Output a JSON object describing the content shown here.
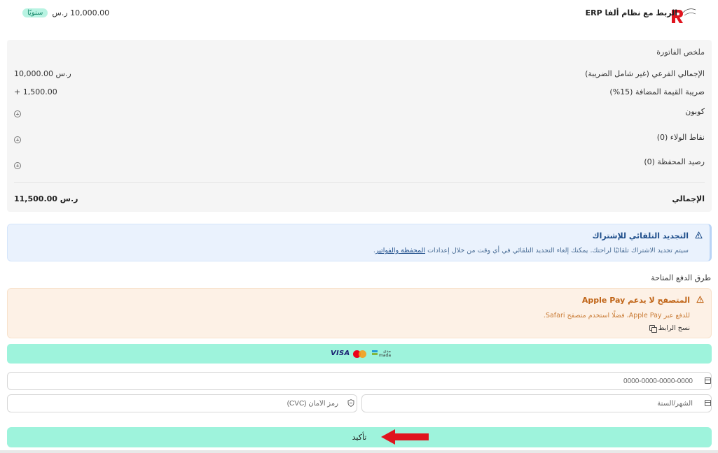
{
  "header": {
    "title": "الربط مع نظام ألفا ERP",
    "price": "10,000.00 ر.س",
    "badge": "سنويًا",
    "logo_icon": "brand-logo-icon"
  },
  "summary": {
    "title": "ملخص الفاتورة",
    "rows": [
      {
        "label": "الإجمالي الفرعي (غير شامل الضريبة)",
        "value": "10,000.00 ر.س"
      },
      {
        "label": "ضريبة القيمة المضافة (15%)",
        "value": "+ 1,500.00"
      },
      {
        "label": "كوبون",
        "icon": "plus-circle-icon"
      },
      {
        "label": "نقاط الولاء (0)",
        "icon": "plus-circle-icon"
      },
      {
        "label": "رصيد المحفظة (0)",
        "icon": "plus-circle-icon"
      }
    ],
    "total_label": "الإجمالي",
    "total_value": "11,500.00 ر.س"
  },
  "renewal": {
    "title": "التجديد التلقائي للإشتراك",
    "text_before": "سيتم تجديد الاشتراك تلقائيًا لراحتك. يمكنك إلغاء التجديد التلقائي في أي وقت من خلال إعدادات",
    "link": "المحفظة والفواتير",
    "text_after": "."
  },
  "payment": {
    "title": "طرق الدفع المتاحة",
    "warning_title": "المتصفح لا يدعم Apple Pay",
    "warning_text": "للدفع عبر Apple Pay، فضلًا استخدم متصفح Safari.",
    "copy_link": "نسخ الرابط",
    "brands": {
      "visa": "VISA",
      "mada_ar": "مدى",
      "mada_en": "mada"
    },
    "card_number_placeholder": "0000-0000-0000-0000",
    "expiry_placeholder": "الشهر/السنة",
    "cvc_placeholder": "رمز الأمان (CVC)",
    "confirm": "تأكيد"
  },
  "colors": {
    "accent": "#9ef3dc",
    "info_bg": "#eaf2fd",
    "warning_bg": "#fdf1e6",
    "arrow": "#e0141e"
  }
}
